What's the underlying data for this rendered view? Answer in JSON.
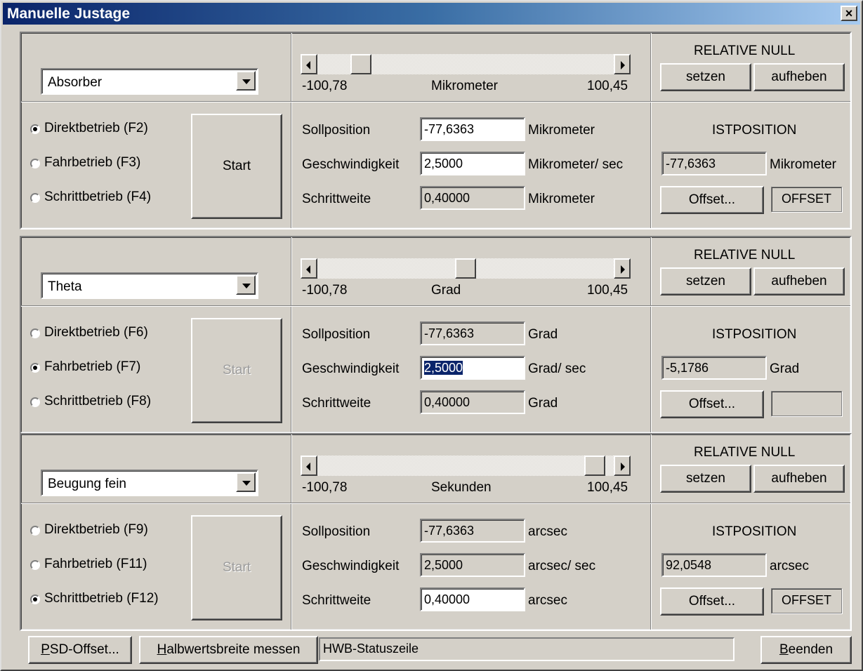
{
  "window": {
    "title": "Manuelle Justage",
    "close_label": "×"
  },
  "axes": [
    {
      "combo_value": "Absorber",
      "range_min": "-100,78",
      "unit_label": "Mikrometer",
      "range_max": "100,45",
      "slider_fraction": 0.12,
      "relative_null": {
        "heading": "RELATIVE NULL",
        "set": "setzen",
        "clear": "aufheben"
      },
      "modes": [
        {
          "label": "Direktbetrieb (F2)",
          "selected": true
        },
        {
          "label": "Fahrbetrieb (F3)",
          "selected": false
        },
        {
          "label": "Schrittbetrieb (F4)",
          "selected": false
        }
      ],
      "start_label": "Start",
      "start_enabled": true,
      "fields": [
        {
          "label": "Sollposition",
          "value": "-77,6363",
          "unit": "Mikrometer",
          "editable": true
        },
        {
          "label": "Geschwindigkeit",
          "value": "2,5000",
          "unit": "Mikrometer/ sec",
          "editable": true
        },
        {
          "label": "Schrittweite",
          "value": "0,40000",
          "unit": "Mikrometer",
          "editable": false
        }
      ],
      "istposition": {
        "heading": "ISTPOSITION",
        "value": "-77,6363",
        "unit": "Mikrometer",
        "offset_button": "Offset...",
        "offset_indicator": "OFFSET"
      }
    },
    {
      "combo_value": "Theta",
      "range_min": "-100,78",
      "unit_label": "Grad",
      "range_max": "100,45",
      "slider_fraction": 0.5,
      "relative_null": {
        "heading": "RELATIVE NULL",
        "set": "setzen",
        "clear": "aufheben"
      },
      "modes": [
        {
          "label": "Direktbetrieb (F6)",
          "selected": false
        },
        {
          "label": "Fahrbetrieb (F7)",
          "selected": true
        },
        {
          "label": "Schrittbetrieb (F8)",
          "selected": false
        }
      ],
      "start_label": "Start",
      "start_enabled": false,
      "fields": [
        {
          "label": "Sollposition",
          "value": "-77,6363",
          "unit": "Grad",
          "editable": false
        },
        {
          "label": "Geschwindigkeit",
          "value": "2,5000",
          "unit": "Grad/ sec",
          "editable": true,
          "selected": true
        },
        {
          "label": "Schrittweite",
          "value": "0,40000",
          "unit": "Grad",
          "editable": false
        }
      ],
      "istposition": {
        "heading": "ISTPOSITION",
        "value": "-5,1786",
        "unit": "Grad",
        "offset_button": "Offset...",
        "offset_indicator": ""
      }
    },
    {
      "combo_value": "Beugung fein",
      "range_min": "-100,78",
      "unit_label": "Sekunden",
      "range_max": "100,45",
      "slider_fraction": 0.97,
      "relative_null": {
        "heading": "RELATIVE NULL",
        "set": "setzen",
        "clear": "aufheben"
      },
      "modes": [
        {
          "label": "Direktbetrieb (F9)",
          "selected": false
        },
        {
          "label": "Fahrbetrieb (F11)",
          "selected": false
        },
        {
          "label": "Schrittbetrieb (F12)",
          "selected": true
        }
      ],
      "start_label": "Start",
      "start_enabled": false,
      "fields": [
        {
          "label": "Sollposition",
          "value": "-77,6363",
          "unit": "arcsec",
          "editable": false
        },
        {
          "label": "Geschwindigkeit",
          "value": "2,5000",
          "unit": "arcsec/ sec",
          "editable": false
        },
        {
          "label": "Schrittweite",
          "value": "0,40000",
          "unit": "arcsec",
          "editable": true
        }
      ],
      "istposition": {
        "heading": "ISTPOSITION",
        "value": "92,0548",
        "unit": "arcsec",
        "offset_button": "Offset...",
        "offset_indicator": "OFFSET"
      }
    }
  ],
  "bottom": {
    "psd_offset": {
      "hotkey": "P",
      "rest": "SD-Offset..."
    },
    "halbwert": {
      "hotkey": "H",
      "rest": "albwertsbreite messen"
    },
    "status_text": "HWB-Statuszeile",
    "beenden": {
      "hotkey": "B",
      "rest": "eenden"
    }
  }
}
